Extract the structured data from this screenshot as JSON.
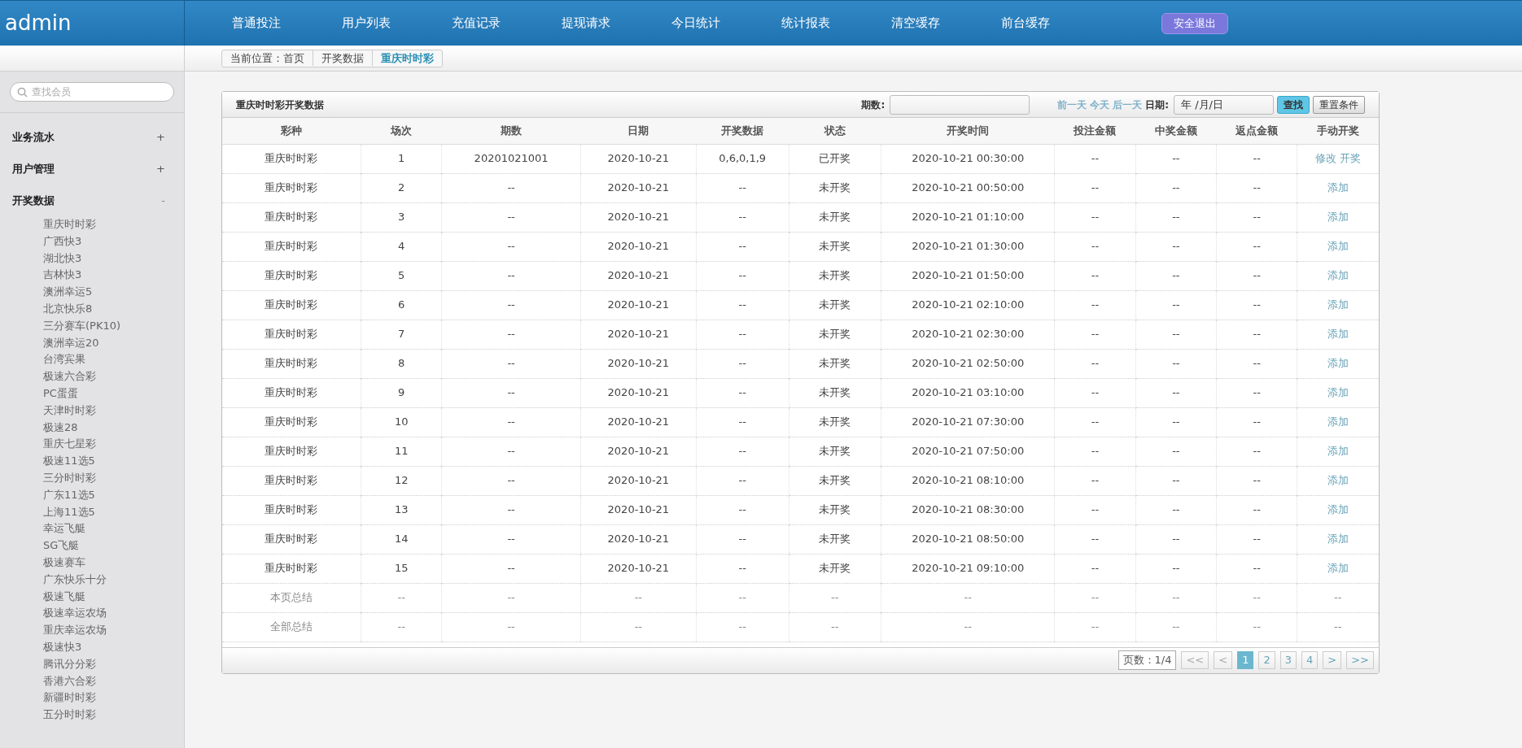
{
  "brand": "admin",
  "nav": [
    "普通投注",
    "用户列表",
    "充值记录",
    "提现请求",
    "今日统计",
    "统计报表",
    "清空缓存",
    "前台缓存"
  ],
  "logout": "安全退出",
  "breadcrumb": [
    "当前位置：首页",
    "开奖数据",
    "重庆时时彩"
  ],
  "search": {
    "placeholder": "查找会员"
  },
  "sidebar": [
    {
      "label": "业务流水",
      "expanded": false,
      "marker": "+"
    },
    {
      "label": "用户管理",
      "expanded": false,
      "marker": "+"
    },
    {
      "label": "开奖数据",
      "expanded": true,
      "marker": "-",
      "children": [
        "重庆时时彩",
        "广西快3",
        "湖北快3",
        "吉林快3",
        "澳洲幸运5",
        "北京快乐8",
        "三分赛车(PK10)",
        "澳洲幸运20",
        "台湾宾果",
        "极速六合彩",
        "PC蛋蛋",
        "天津时时彩",
        "极速28",
        "重庆七星彩",
        "极速11选5",
        "三分时时彩",
        "广东11选5",
        "上海11选5",
        "幸运飞艇",
        "SG飞艇",
        "极速赛车",
        "广东快乐十分",
        "极速飞艇",
        "极速幸运农场",
        "重庆幸运农场",
        "极速快3",
        "腾讯分分彩",
        "香港六合彩",
        "新疆时时彩",
        "五分时时彩"
      ]
    }
  ],
  "panel": {
    "title": "重庆时时彩开奖数据",
    "issue_label": "期数:",
    "day_links": [
      "前一天",
      "今天",
      "后一天"
    ],
    "date_label": "日期:",
    "date_value": "年 /月/日",
    "search_button": "查找",
    "reset_button": "重置条件"
  },
  "table": {
    "columns": [
      "彩种",
      "场次",
      "期数",
      "日期",
      "开奖数据",
      "状态",
      "开奖时间",
      "投注金额",
      "中奖金额",
      "返点金额",
      "手动开奖"
    ],
    "rows": [
      {
        "kind": "data",
        "cells": [
          "重庆时时彩",
          "1",
          "20201021001",
          "2020-10-21",
          "0,6,0,1,9",
          "已开奖",
          "2020-10-21 00:30:00",
          "--",
          "--",
          "--"
        ],
        "actions": [
          "修改",
          "开奖"
        ]
      },
      {
        "kind": "data",
        "cells": [
          "重庆时时彩",
          "2",
          "--",
          "2020-10-21",
          "--",
          "未开奖",
          "2020-10-21 00:50:00",
          "--",
          "--",
          "--"
        ],
        "actions": [
          "添加"
        ]
      },
      {
        "kind": "data",
        "cells": [
          "重庆时时彩",
          "3",
          "--",
          "2020-10-21",
          "--",
          "未开奖",
          "2020-10-21 01:10:00",
          "--",
          "--",
          "--"
        ],
        "actions": [
          "添加"
        ]
      },
      {
        "kind": "data",
        "cells": [
          "重庆时时彩",
          "4",
          "--",
          "2020-10-21",
          "--",
          "未开奖",
          "2020-10-21 01:30:00",
          "--",
          "--",
          "--"
        ],
        "actions": [
          "添加"
        ]
      },
      {
        "kind": "data",
        "cells": [
          "重庆时时彩",
          "5",
          "--",
          "2020-10-21",
          "--",
          "未开奖",
          "2020-10-21 01:50:00",
          "--",
          "--",
          "--"
        ],
        "actions": [
          "添加"
        ]
      },
      {
        "kind": "data",
        "cells": [
          "重庆时时彩",
          "6",
          "--",
          "2020-10-21",
          "--",
          "未开奖",
          "2020-10-21 02:10:00",
          "--",
          "--",
          "--"
        ],
        "actions": [
          "添加"
        ]
      },
      {
        "kind": "data",
        "cells": [
          "重庆时时彩",
          "7",
          "--",
          "2020-10-21",
          "--",
          "未开奖",
          "2020-10-21 02:30:00",
          "--",
          "--",
          "--"
        ],
        "actions": [
          "添加"
        ]
      },
      {
        "kind": "data",
        "cells": [
          "重庆时时彩",
          "8",
          "--",
          "2020-10-21",
          "--",
          "未开奖",
          "2020-10-21 02:50:00",
          "--",
          "--",
          "--"
        ],
        "actions": [
          "添加"
        ]
      },
      {
        "kind": "data",
        "cells": [
          "重庆时时彩",
          "9",
          "--",
          "2020-10-21",
          "--",
          "未开奖",
          "2020-10-21 03:10:00",
          "--",
          "--",
          "--"
        ],
        "actions": [
          "添加"
        ]
      },
      {
        "kind": "data",
        "cells": [
          "重庆时时彩",
          "10",
          "--",
          "2020-10-21",
          "--",
          "未开奖",
          "2020-10-21 07:30:00",
          "--",
          "--",
          "--"
        ],
        "actions": [
          "添加"
        ]
      },
      {
        "kind": "data",
        "cells": [
          "重庆时时彩",
          "11",
          "--",
          "2020-10-21",
          "--",
          "未开奖",
          "2020-10-21 07:50:00",
          "--",
          "--",
          "--"
        ],
        "actions": [
          "添加"
        ]
      },
      {
        "kind": "data",
        "cells": [
          "重庆时时彩",
          "12",
          "--",
          "2020-10-21",
          "--",
          "未开奖",
          "2020-10-21 08:10:00",
          "--",
          "--",
          "--"
        ],
        "actions": [
          "添加"
        ]
      },
      {
        "kind": "data",
        "cells": [
          "重庆时时彩",
          "13",
          "--",
          "2020-10-21",
          "--",
          "未开奖",
          "2020-10-21 08:30:00",
          "--",
          "--",
          "--"
        ],
        "actions": [
          "添加"
        ]
      },
      {
        "kind": "data",
        "cells": [
          "重庆时时彩",
          "14",
          "--",
          "2020-10-21",
          "--",
          "未开奖",
          "2020-10-21 08:50:00",
          "--",
          "--",
          "--"
        ],
        "actions": [
          "添加"
        ]
      },
      {
        "kind": "data",
        "cells": [
          "重庆时时彩",
          "15",
          "--",
          "2020-10-21",
          "--",
          "未开奖",
          "2020-10-21 09:10:00",
          "--",
          "--",
          "--"
        ],
        "actions": [
          "添加"
        ]
      },
      {
        "kind": "summary",
        "cells": [
          "本页总结",
          "--",
          "--",
          "--",
          "--",
          "--",
          "--",
          "--",
          "--",
          "--",
          "--"
        ]
      },
      {
        "kind": "summary",
        "cells": [
          "全部总结",
          "--",
          "--",
          "--",
          "--",
          "--",
          "--",
          "--",
          "--",
          "--",
          "--"
        ]
      }
    ]
  },
  "pagination": {
    "info": "页数：1/4",
    "first": "<<",
    "prev": "<",
    "pages": [
      {
        "label": "1",
        "selected": true
      },
      {
        "label": "2",
        "selected": false
      },
      {
        "label": "3",
        "selected": false
      },
      {
        "label": "4",
        "selected": false
      }
    ],
    "next": ">",
    "last": ">>"
  }
}
